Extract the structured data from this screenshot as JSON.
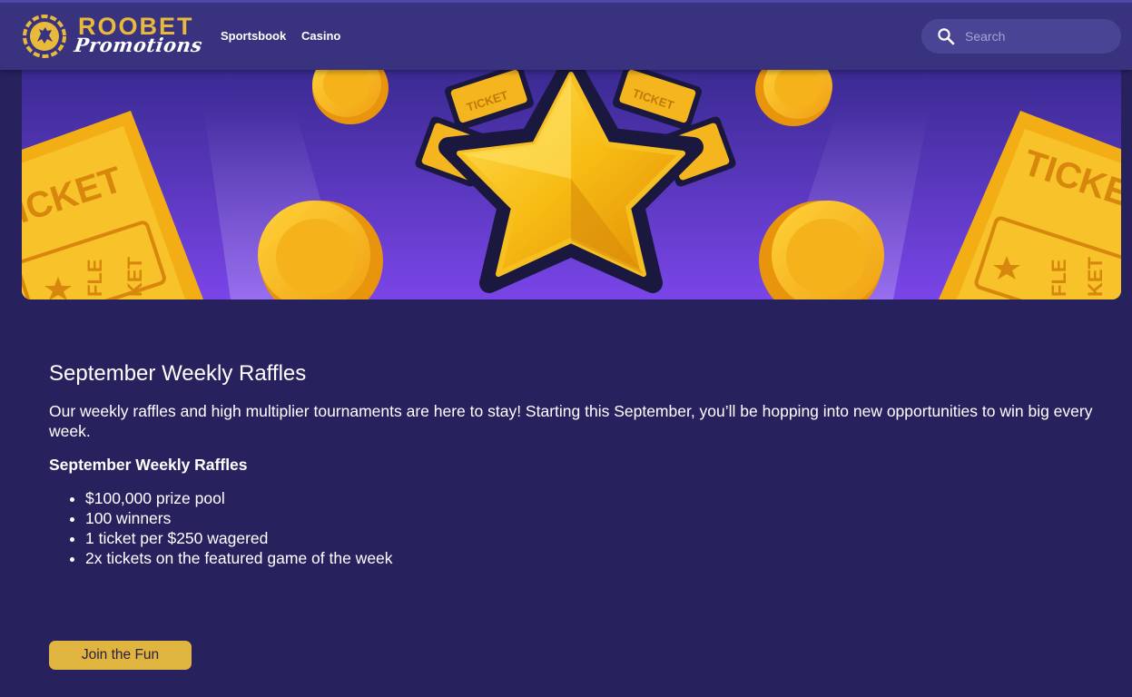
{
  "brand": {
    "name_top": "ROOBET",
    "name_bottom": "Promotions",
    "accent_color": "#e9b93c"
  },
  "nav": {
    "items": [
      {
        "label": "Sportsbook"
      },
      {
        "label": "Casino"
      }
    ]
  },
  "search": {
    "placeholder": "Search",
    "value": "",
    "icon": "search-icon"
  },
  "banner": {
    "ticket_text": "TICKET",
    "ticket_left_text": "ICKET",
    "ticket_right_text": "TICKE",
    "raffle_text_left": "FLE",
    "raffle_text_left2": "KET",
    "raffle_text_right": "FLE",
    "raffle_text_right2": "KET",
    "colors": {
      "background": "#5a33c9",
      "gold": "#f5b91c",
      "gold_dark": "#d98c0a",
      "star_outline": "#1b1840"
    }
  },
  "article": {
    "title": "September Weekly Raffles",
    "intro": "Our weekly raffles and high multiplier tournaments are here to stay! Starting this September, you’ll be hopping into new opportunities to win big every week.",
    "subtitle": "September Weekly Raffles",
    "bullets": [
      "$100,000 prize pool",
      "100 winners",
      "1 ticket per $250 wagered",
      "2x tickets on the featured game of the week"
    ]
  },
  "cta": {
    "label": "Join the Fun",
    "color": "#e0b53f"
  }
}
